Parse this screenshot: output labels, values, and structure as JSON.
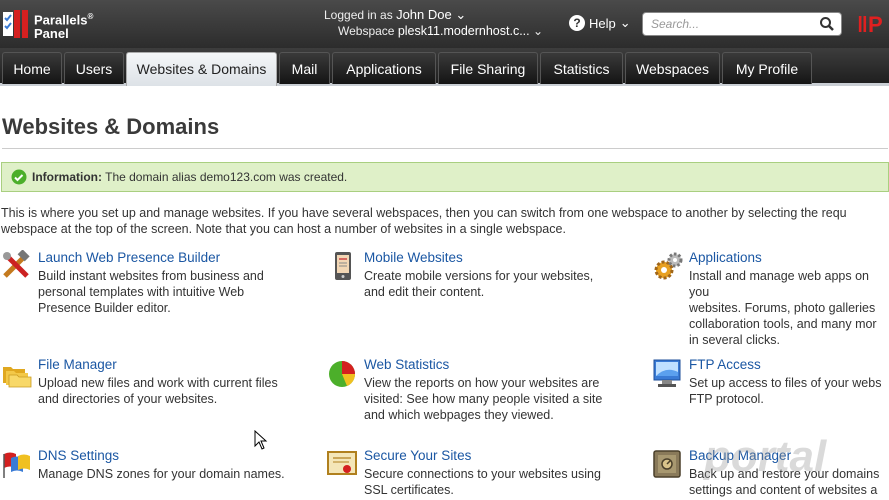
{
  "header": {
    "logo_line1": "Parallels",
    "logo_line2": "Panel",
    "logged_in_label": "Logged in as",
    "user_name": "John Doe",
    "webspace_label": "Webspace",
    "webspace_value": "plesk11.modernhost.c...",
    "help_label": "Help",
    "search_placeholder": "Search..."
  },
  "tabs": [
    {
      "label": "Home"
    },
    {
      "label": "Users"
    },
    {
      "label": "Websites & Domains",
      "active": true
    },
    {
      "label": "Mail"
    },
    {
      "label": "Applications"
    },
    {
      "label": "File Sharing"
    },
    {
      "label": "Statistics"
    },
    {
      "label": "Webspaces"
    },
    {
      "label": "My Profile"
    }
  ],
  "page": {
    "title": "Websites & Domains",
    "info_label": "Information:",
    "info_text": "The domain alias demo123.com was created.",
    "intro_line1": "This is where you set up and manage websites. If you have several webspaces, then you can switch from one webspace to another by selecting the requ",
    "intro_line2": "webspace at the top of the screen. Note that you can host a number of websites in a single webspace."
  },
  "features": [
    {
      "title": "Launch Web Presence Builder",
      "desc": [
        "Build instant websites from business and",
        "personal templates with intuitive Web",
        "Presence Builder editor."
      ],
      "icon": "tools-icon"
    },
    {
      "title": "Mobile Websites",
      "desc": [
        "Create mobile versions for your websites,",
        "and edit their content."
      ],
      "icon": "mobile-icon"
    },
    {
      "title": "Applications",
      "desc": [
        "Install and manage web apps on you",
        "websites. Forums, photo galleries",
        "collaboration tools, and many mor",
        "in several clicks."
      ],
      "icon": "gears-icon"
    },
    {
      "title": "File Manager",
      "desc": [
        "Upload new files and work with current files",
        "and directories of your websites."
      ],
      "icon": "folders-icon"
    },
    {
      "title": "Web Statistics",
      "desc": [
        "View the reports on how your websites are",
        "visited: See how many people visited a site",
        "and which webpages they viewed."
      ],
      "icon": "pie-chart-icon"
    },
    {
      "title": "FTP Access",
      "desc": [
        "Set up access to files of your webs",
        "FTP protocol."
      ],
      "icon": "ftp-icon"
    },
    {
      "title": "DNS Settings",
      "desc": [
        "Manage DNS zones for your domain names."
      ],
      "icon": "flags-icon"
    },
    {
      "title": "Secure Your Sites",
      "desc": [
        "Secure connections to your websites using",
        "SSL certificates."
      ],
      "icon": "certificate-icon"
    },
    {
      "title": "Backup Manager",
      "desc": [
        "Back up and restore your domains",
        "settings and content of websites a"
      ],
      "icon": "safe-icon"
    }
  ],
  "colors": {
    "link": "#1b57a3",
    "info_bg": "#dff0c8",
    "header_bg": "#2c2c2c"
  }
}
